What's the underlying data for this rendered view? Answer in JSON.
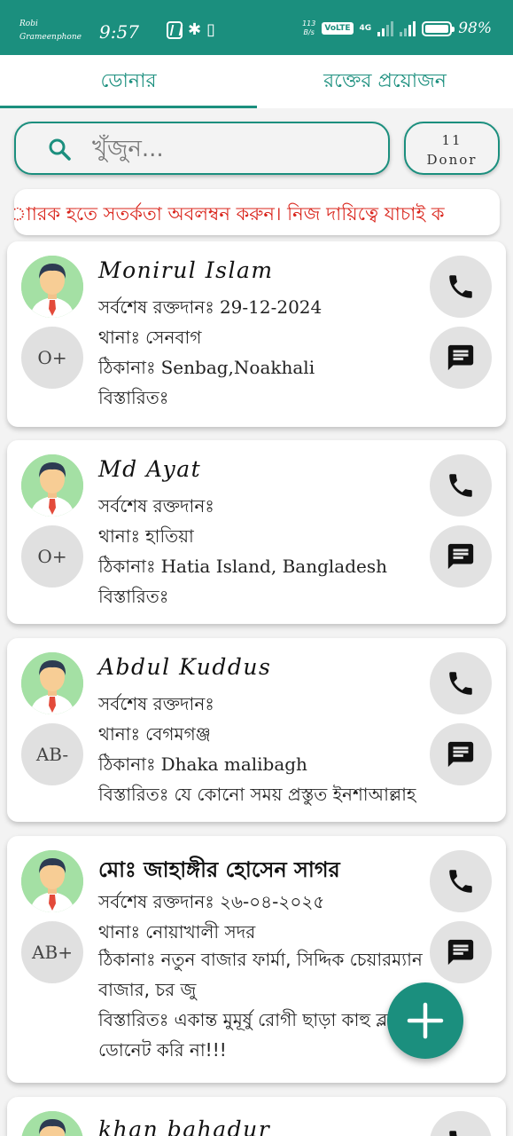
{
  "status_bar": {
    "carrier_1": "Robi",
    "carrier_2": "Grameenphone",
    "time": "9:57",
    "speed_top": "113",
    "speed_bottom": "B/s",
    "volte": "VoLTE",
    "network": "4G",
    "battery_percent": "98%",
    "battery_level": 0.98
  },
  "tabs": [
    {
      "label": "ডোনার",
      "active": true
    },
    {
      "label": "রক্তের প্রয়োজন",
      "active": false
    }
  ],
  "search": {
    "placeholder": "খুঁজুন..."
  },
  "donor_count": {
    "number": "11",
    "label": "Donor"
  },
  "warning": "াারক হতে সতর্কতা অবলম্বন করুন। নিজ দায়িত্বে যাচাই ক",
  "labels": {
    "last_donation": "সর্বশেষ রক্তদানঃ",
    "thana": "থানাঃ",
    "address": "ঠিকানাঃ",
    "details": "বিস্তারিতঃ"
  },
  "donors": [
    {
      "name": "Monirul Islam",
      "last_donation": "29-12-2024",
      "thana": "সেনবাগ",
      "address": "Senbag,Noakhali",
      "details": "",
      "blood_group": "O+"
    },
    {
      "name": "Md Ayat",
      "last_donation": "",
      "thana": "হাতিয়া",
      "address": "Hatia Island, Bangladesh",
      "details": "",
      "blood_group": "O+"
    },
    {
      "name": "Abdul Kuddus",
      "last_donation": "",
      "thana": "বেগমগঞ্জ",
      "address": "Dhaka malibagh",
      "details": "যে কোনো সময় প্রস্তুত ইনশাআল্লাহ",
      "blood_group": "AB-"
    },
    {
      "name": "মোঃ জাহাঙ্গীর হোসেন সাগর",
      "last_donation": "২৬-০৪-২০২৫",
      "thana": "নোয়াখালী সদর",
      "address": "নতুন বাজার ফার্মা, সিদ্দিক চেয়ারম্যান বাজার, চর জু",
      "details": "একান্ত মুমূর্ষু রোগী ছাড়া কাহু ব্লাড ডোনেট করি না!!!",
      "blood_group": "AB+"
    },
    {
      "name": "khan bahadur",
      "last_donation": "",
      "thana": "",
      "address": "",
      "details": "",
      "blood_group": ""
    }
  ],
  "colors": {
    "primary": "#1b8f7e",
    "warning": "#d9241b",
    "badge": "#e0e0e0"
  },
  "icons": [
    "search-icon",
    "phone-icon",
    "message-icon",
    "plus-icon",
    "person-avatar-icon"
  ]
}
